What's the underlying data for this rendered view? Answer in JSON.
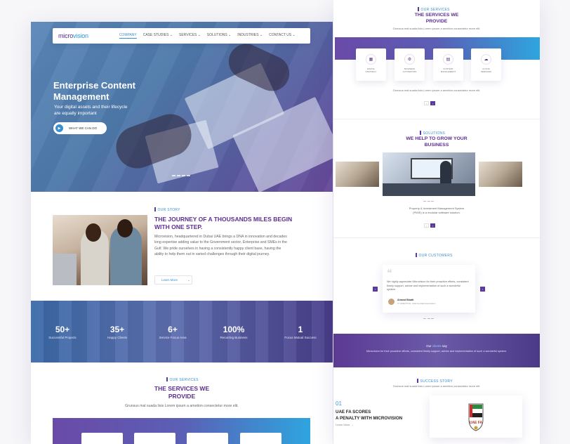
{
  "brand": {
    "logo_part1": "micro",
    "logo_part2": "vision"
  },
  "nav": {
    "items": [
      "COMPANY",
      "CASE STUDIES ⌄",
      "SERVICES ⌄",
      "SOLUTIONS ⌄",
      "INDUSTRIES ⌄",
      "CONTACT US ⌄"
    ]
  },
  "hero": {
    "title": "Enterprise Content Management",
    "subtitle": "Your digital assets and their lifecycle are equally important",
    "cta": "WHAT WE CAN DO"
  },
  "story": {
    "tag": "OUR STORY",
    "title": "THE JOURNEY OF A THOUSANDS MILES BEGIN WITH ONE STEP.",
    "body": "Microvision, headquartered in Dubai UAE brings a DNA in innovation and decades long expertise adding value to the Government sector, Enterprise and SMEs in the Gulf. We pride ourselves in having a consistently happy client base, having the ability to help them out in varied challenges through their digital journey.",
    "more": "Learn More"
  },
  "stats": [
    {
      "value": "50+",
      "label": "Successful Projects"
    },
    {
      "value": "35+",
      "label": "Happy Clients"
    },
    {
      "value": "6+",
      "label": "Service Focus Area"
    },
    {
      "value": "100%",
      "label": "Recurring Business"
    },
    {
      "value": "1",
      "label": "Focus Mutual Success"
    }
  ],
  "services": {
    "tag": "OUR SERVICES",
    "title_line1": "THE SERVICES WE",
    "title_line2": "PROVIDE",
    "desc": "Grunsus mal suada lisis Lorem ipsum a ametion consectetur more elit."
  },
  "right": {
    "services": {
      "tag": "OUR SERVICES",
      "title_line1": "THE SERVICES WE",
      "title_line2": "PROVIDE",
      "desc": "Grunsus mal suada lisis Lorem ipsum a ametion consectetur more elit.",
      "cards": [
        {
          "l1": "DIGITAL",
          "l2": "STRATEGY"
        },
        {
          "l1": "BUSINESS",
          "l2": "AUTOMATION"
        },
        {
          "l1": "CONTENT",
          "l2": "MANAGEMENT"
        },
        {
          "l1": "CLOUD",
          "l2": "SERVICES"
        }
      ],
      "desc2": "Grunsus mal suada lisis Lorem ipsum a ametion consectetur more elit."
    },
    "solutions": {
      "tag": "SOLUTIONS",
      "title_line1": "WE HELP TO GROW YOUR",
      "title_line2": "BUSINESS",
      "desc_line1": "Property & Investment Management System",
      "desc_line2": "(PIMS) is a modular software solution."
    },
    "customers": {
      "tag": "OUR CUSTOMERS",
      "quote": "We highly appreciate Microvision for their proactive efforts, consistent timely support, advice and implementation of such a wonderful system.",
      "name": "Ahmed Bhatti",
      "role": "IT DIRECTOR, UAE Football Association"
    },
    "band": {
      "pre": "Our ",
      "hl": "clients",
      "post": " say",
      "text": "Microvision for their proactive efforts, consistent timely support, advice and implementation of such a wonderful system."
    },
    "success": {
      "tag": "SUCCESS STORY",
      "desc": "Grunsus mal suada lisis Lorem ipsum a ametion consectetur more elit.",
      "num": "01",
      "title_line1": "UAE FA SCORES",
      "title_line2": "A PENALTY WITH MICROVISION",
      "more": "Learn More →",
      "badge_text": "UAE FA"
    }
  },
  "colors": {
    "accent": "#3a8fd0",
    "brand": "#5b2d90"
  }
}
